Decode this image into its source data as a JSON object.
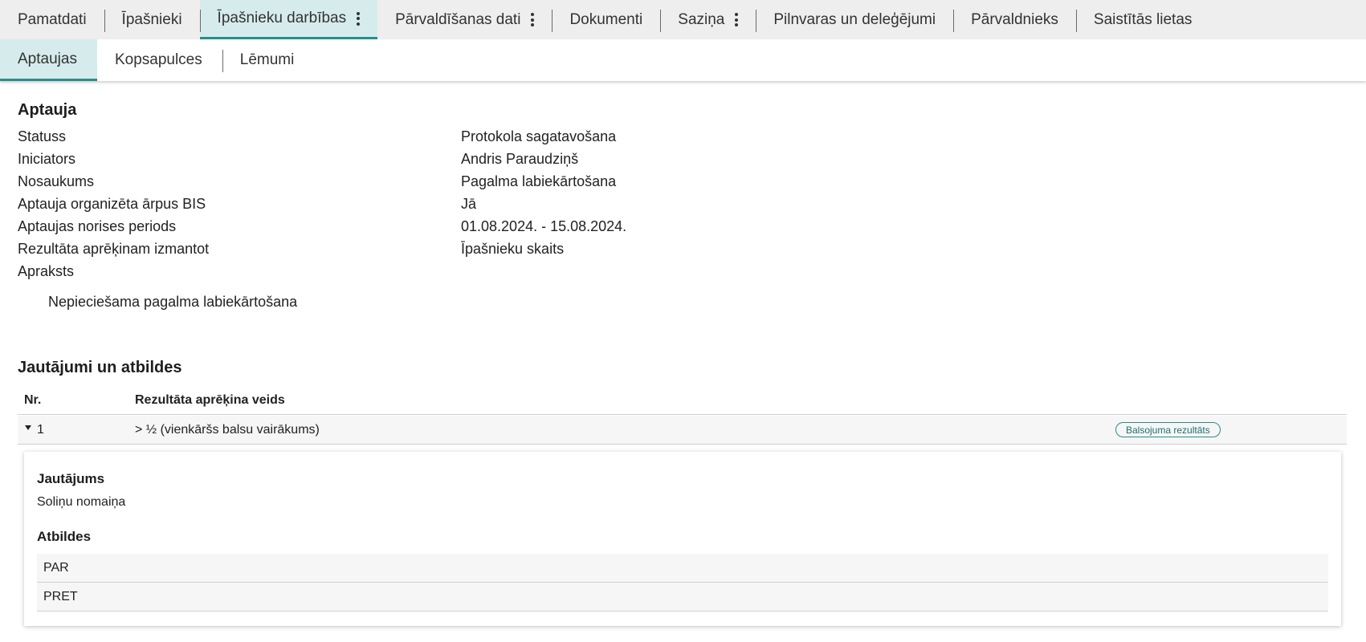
{
  "top_tabs": [
    {
      "label": "Pamatdati",
      "active": false,
      "has_menu": false
    },
    {
      "label": "Īpašnieki",
      "active": false,
      "has_menu": false
    },
    {
      "label": "Īpašnieku darbības",
      "active": true,
      "has_menu": true
    },
    {
      "label": "Pārvaldīšanas dati",
      "active": false,
      "has_menu": true
    },
    {
      "label": "Dokumenti",
      "active": false,
      "has_menu": false
    },
    {
      "label": "Saziņa",
      "active": false,
      "has_menu": true
    },
    {
      "label": "Pilnvaras un deleģējumi",
      "active": false,
      "has_menu": false
    },
    {
      "label": "Pārvaldnieks",
      "active": false,
      "has_menu": false
    },
    {
      "label": "Saistītās lietas",
      "active": false,
      "has_menu": false
    }
  ],
  "sub_tabs": [
    {
      "label": "Aptaujas",
      "active": true
    },
    {
      "label": "Kopsapulces",
      "active": false
    },
    {
      "label": "Lēmumi",
      "active": false
    }
  ],
  "survey": {
    "title": "Aptauja",
    "fields": [
      {
        "label": "Statuss",
        "value": "Protokola sagatavošana"
      },
      {
        "label": "Iniciators",
        "value": "Andris Paraudziņš"
      },
      {
        "label": "Nosaukums",
        "value": "Pagalma labiekārtošana"
      },
      {
        "label": "Aptauja organizēta ārpus BIS",
        "value": "Jā"
      },
      {
        "label": "Aptaujas norises periods",
        "value": "01.08.2024. - 15.08.2024."
      },
      {
        "label": "Rezultāta aprēķinam izmantot",
        "value": "Īpašnieku skaits"
      },
      {
        "label": "Apraksts",
        "value": ""
      }
    ],
    "description": "Nepieciešama pagalma labiekārtošana"
  },
  "questions": {
    "title": "Jautājumi un atbildes",
    "columns": {
      "nr": "Nr.",
      "type": "Rezultāta aprēķina veids"
    },
    "rows": [
      {
        "nr": "1",
        "type": "> ½ (vienkāršs balsu vairākums)",
        "badge": "Balsojuma rezultāts",
        "expanded": true,
        "question_heading": "Jautājums",
        "question_text": "Soliņu nomaiņa",
        "answers_heading": "Atbildes",
        "answers": [
          "PAR",
          "PRET"
        ]
      }
    ]
  },
  "colors": {
    "accent": "#2a8c8c",
    "active_tab_bg": "#d6ecec",
    "tab_bar_bg": "#eeeeee",
    "row_bg": "#f6f6f6"
  }
}
